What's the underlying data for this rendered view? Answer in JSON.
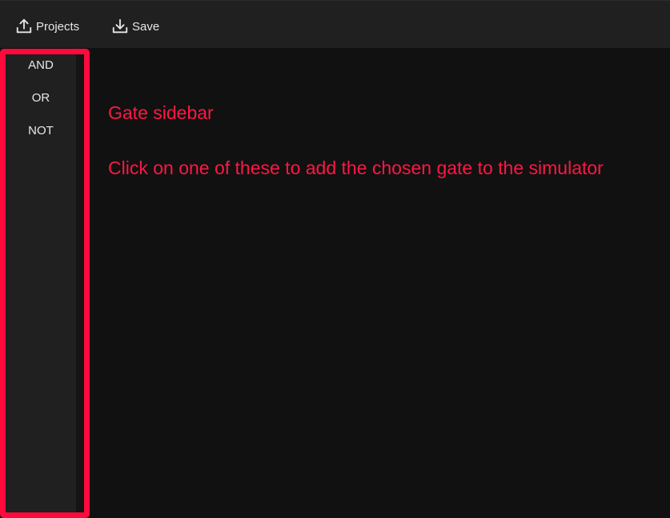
{
  "toolbar": {
    "projects_label": "Projects",
    "save_label": "Save"
  },
  "sidebar": {
    "gates": [
      {
        "label": "AND"
      },
      {
        "label": "OR"
      },
      {
        "label": "NOT"
      }
    ]
  },
  "annotation": {
    "title": "Gate sidebar",
    "description": "Click on one of these to add the chosen gate to the simulator"
  },
  "colors": {
    "highlight": "#ff0a3c",
    "annotation_text": "#ff1744",
    "topbar_bg": "#202020",
    "canvas_bg": "#111111"
  },
  "icons": {
    "projects": "upload-icon",
    "save": "download-icon"
  }
}
